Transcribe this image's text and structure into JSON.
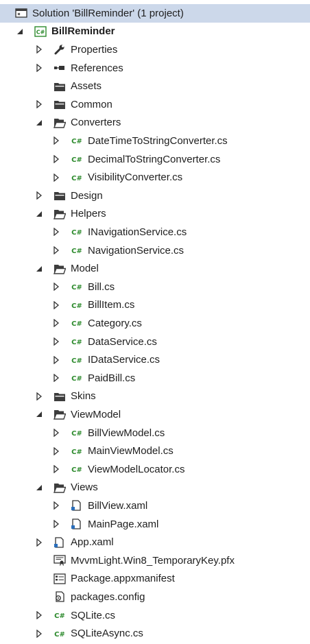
{
  "solution_explorer": {
    "items": [
      {
        "label": "Solution 'BillReminder' (1 project)",
        "level": 0,
        "expander": "none",
        "icon": "solution-icon",
        "selected": true,
        "bold": false
      },
      {
        "label": "BillReminder",
        "level": 0,
        "expander": "expanded",
        "icon": "csharp-project-icon",
        "selected": false,
        "bold": true
      },
      {
        "label": "Properties",
        "level": 1,
        "expander": "collapsed",
        "icon": "wrench-icon"
      },
      {
        "label": "References",
        "level": 1,
        "expander": "collapsed",
        "icon": "references-icon"
      },
      {
        "label": "Assets",
        "level": 1,
        "expander": "none",
        "icon": "folder-icon"
      },
      {
        "label": "Common",
        "level": 1,
        "expander": "collapsed",
        "icon": "folder-icon"
      },
      {
        "label": "Converters",
        "level": 1,
        "expander": "expanded",
        "icon": "folder-open-icon"
      },
      {
        "label": "DateTimeToStringConverter.cs",
        "level": 2,
        "expander": "collapsed",
        "icon": "csharp-file-icon"
      },
      {
        "label": "DecimalToStringConverter.cs",
        "level": 2,
        "expander": "collapsed",
        "icon": "csharp-file-icon"
      },
      {
        "label": "VisibilityConverter.cs",
        "level": 2,
        "expander": "collapsed",
        "icon": "csharp-file-icon"
      },
      {
        "label": "Design",
        "level": 1,
        "expander": "collapsed",
        "icon": "folder-icon"
      },
      {
        "label": "Helpers",
        "level": 1,
        "expander": "expanded",
        "icon": "folder-open-icon"
      },
      {
        "label": "INavigationService.cs",
        "level": 2,
        "expander": "collapsed",
        "icon": "csharp-file-icon"
      },
      {
        "label": "NavigationService.cs",
        "level": 2,
        "expander": "collapsed",
        "icon": "csharp-file-icon"
      },
      {
        "label": "Model",
        "level": 1,
        "expander": "expanded",
        "icon": "folder-open-icon"
      },
      {
        "label": "Bill.cs",
        "level": 2,
        "expander": "collapsed",
        "icon": "csharp-file-icon"
      },
      {
        "label": "BillItem.cs",
        "level": 2,
        "expander": "collapsed",
        "icon": "csharp-file-icon"
      },
      {
        "label": "Category.cs",
        "level": 2,
        "expander": "collapsed",
        "icon": "csharp-file-icon"
      },
      {
        "label": "DataService.cs",
        "level": 2,
        "expander": "collapsed",
        "icon": "csharp-file-icon"
      },
      {
        "label": "IDataService.cs",
        "level": 2,
        "expander": "collapsed",
        "icon": "csharp-file-icon"
      },
      {
        "label": "PaidBill.cs",
        "level": 2,
        "expander": "collapsed",
        "icon": "csharp-file-icon"
      },
      {
        "label": "Skins",
        "level": 1,
        "expander": "collapsed",
        "icon": "folder-icon"
      },
      {
        "label": "ViewModel",
        "level": 1,
        "expander": "expanded",
        "icon": "folder-open-icon"
      },
      {
        "label": "BillViewModel.cs",
        "level": 2,
        "expander": "collapsed",
        "icon": "csharp-file-icon"
      },
      {
        "label": "MainViewModel.cs",
        "level": 2,
        "expander": "collapsed",
        "icon": "csharp-file-icon"
      },
      {
        "label": "ViewModelLocator.cs",
        "level": 2,
        "expander": "collapsed",
        "icon": "csharp-file-icon"
      },
      {
        "label": "Views",
        "level": 1,
        "expander": "expanded",
        "icon": "folder-open-icon"
      },
      {
        "label": "BillView.xaml",
        "level": 2,
        "expander": "collapsed",
        "icon": "xaml-file-icon"
      },
      {
        "label": "MainPage.xaml",
        "level": 2,
        "expander": "collapsed",
        "icon": "xaml-file-icon"
      },
      {
        "label": "App.xaml",
        "level": 1,
        "expander": "collapsed",
        "icon": "xaml-file-icon"
      },
      {
        "label": "MvvmLight.Win8_TemporaryKey.pfx",
        "level": 1,
        "expander": "none",
        "icon": "certificate-icon"
      },
      {
        "label": "Package.appxmanifest",
        "level": 1,
        "expander": "none",
        "icon": "manifest-icon"
      },
      {
        "label": "packages.config",
        "level": 1,
        "expander": "none",
        "icon": "config-icon"
      },
      {
        "label": "SQLite.cs",
        "level": 1,
        "expander": "collapsed",
        "icon": "csharp-file-icon"
      },
      {
        "label": "SQLiteAsync.cs",
        "level": 1,
        "expander": "collapsed",
        "icon": "csharp-file-icon"
      }
    ]
  }
}
